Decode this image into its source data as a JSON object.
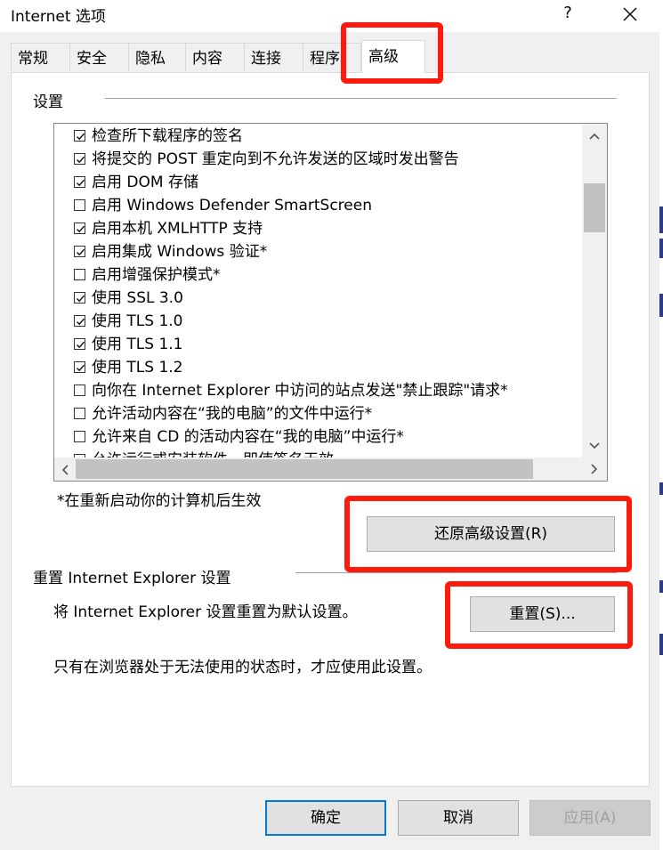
{
  "window": {
    "title": "Internet 选项",
    "help_label": "?"
  },
  "tabs": [
    {
      "label": "常规",
      "active": false
    },
    {
      "label": "安全",
      "active": false
    },
    {
      "label": "隐私",
      "active": false
    },
    {
      "label": "内容",
      "active": false
    },
    {
      "label": "连接",
      "active": false
    },
    {
      "label": "程序",
      "active": false
    },
    {
      "label": "高级",
      "active": true
    }
  ],
  "settings": {
    "group_label": "设置",
    "items": [
      {
        "label": "检查所下载程序的签名",
        "checked": true
      },
      {
        "label": "将提交的 POST 重定向到不允许发送的区域时发出警告",
        "checked": true
      },
      {
        "label": "启用 DOM 存储",
        "checked": true
      },
      {
        "label": "启用 Windows Defender SmartScreen",
        "checked": false
      },
      {
        "label": "启用本机 XMLHTTP 支持",
        "checked": true
      },
      {
        "label": "启用集成 Windows 验证*",
        "checked": true
      },
      {
        "label": "启用增强保护模式*",
        "checked": false
      },
      {
        "label": "使用 SSL 3.0",
        "checked": true
      },
      {
        "label": "使用 TLS 1.0",
        "checked": true
      },
      {
        "label": "使用 TLS 1.1",
        "checked": true
      },
      {
        "label": "使用 TLS 1.2",
        "checked": true
      },
      {
        "label": "向你在 Internet Explorer 中访问的站点发送\"禁止跟踪\"请求*",
        "checked": false
      },
      {
        "label": "允许活动内容在“我的电脑”的文件中运行*",
        "checked": false
      },
      {
        "label": "允许来自 CD 的活动内容在“我的电脑”中运行*",
        "checked": false
      },
      {
        "label": "允许运行或安装软件，即使签名无效",
        "checked": false
      }
    ],
    "restart_note": "*在重新启动你的计算机后生效",
    "restore_button": "还原高级设置(R)"
  },
  "reset": {
    "group_label": "重置 Internet Explorer 设置",
    "description": "将 Internet Explorer 设置重置为默认设置。",
    "button": "重置(S)...",
    "note": "只有在浏览器处于无法使用的状态时，才应使用此设置。"
  },
  "footer": {
    "ok": "确定",
    "cancel": "取消",
    "apply": "应用(A)"
  },
  "colors": {
    "highlight_box": "#ff1a0e",
    "default_button_border": "#0078d7"
  }
}
